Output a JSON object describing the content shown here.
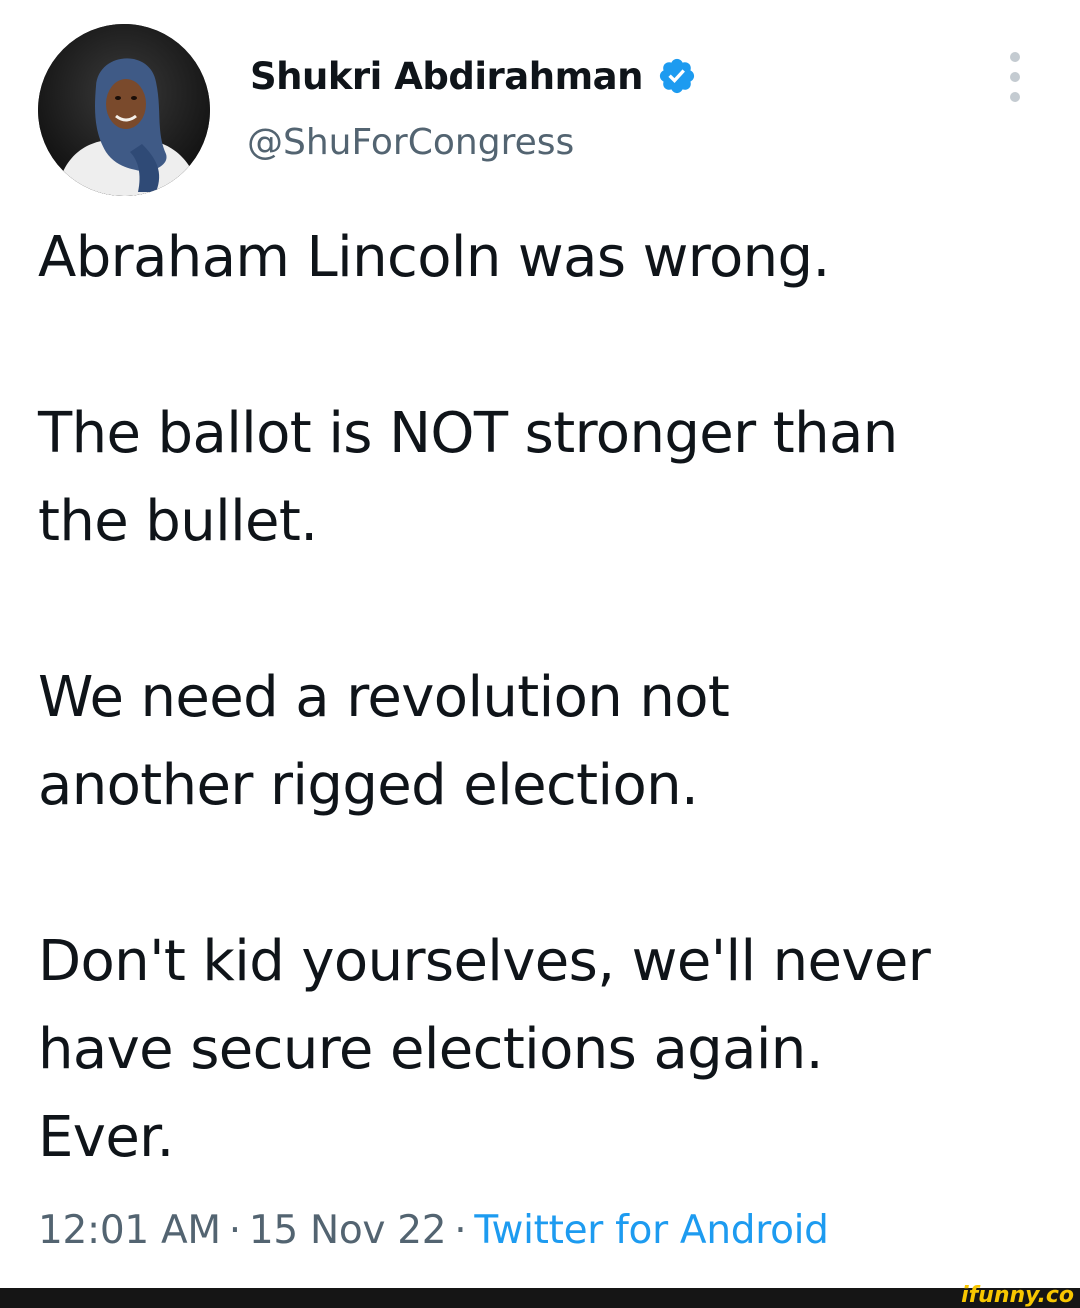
{
  "author": {
    "display_name": "Shukri Abdirahman",
    "handle": "@ShuForCongress",
    "verified": true,
    "avatar_icon": "profile-photo-avatar"
  },
  "menu": {
    "more_icon": "more-vertical-icon"
  },
  "tweet": {
    "paragraphs": [
      "Abraham Lincoln was wrong.",
      "The ballot is NOT stronger than\nthe bullet.",
      "We need a revolution not\nanother rigged election.",
      "Don't kid yourselves, we'll never\nhave secure elections again.\nEver."
    ]
  },
  "meta": {
    "time": "12:01 AM",
    "separator": "·",
    "date": "15 Nov 22",
    "source": "Twitter for Android"
  },
  "watermark": {
    "text": "ifunny.co"
  },
  "colors": {
    "text_primary": "#0f1419",
    "text_secondary": "#536471",
    "accent": "#1d9bf0",
    "watermark": "#f7c600",
    "watermark_bar": "#151515"
  }
}
